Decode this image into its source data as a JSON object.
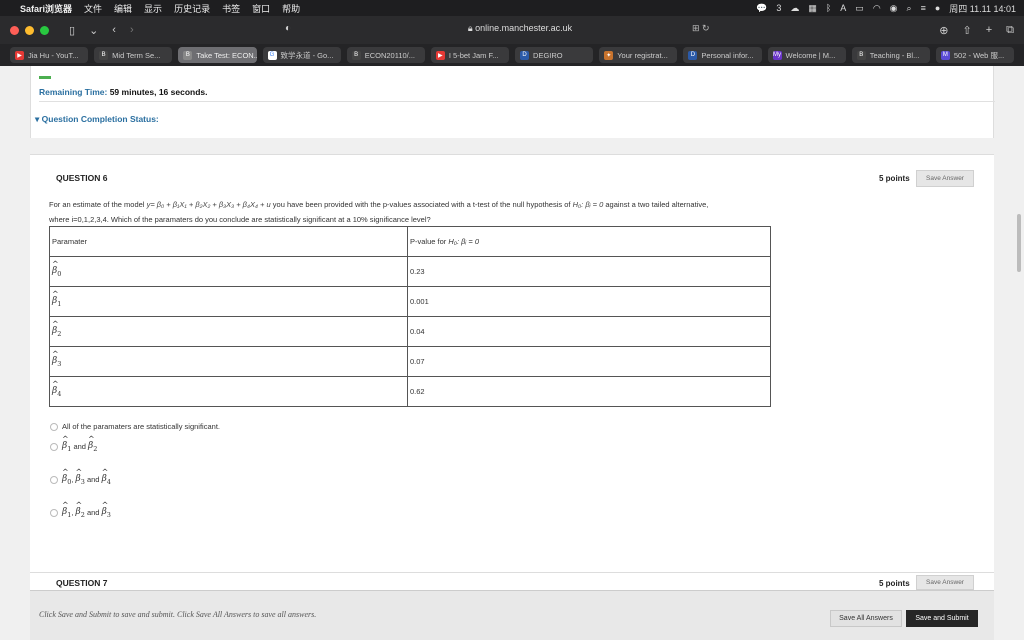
{
  "menubar": {
    "app": "Safari浏览器",
    "items": [
      "文件",
      "编辑",
      "显示",
      "历史记录",
      "书签",
      "窗口",
      "帮助"
    ],
    "wechat_count": "3",
    "clock": "周四 11.11  14:01"
  },
  "browser": {
    "url": "online.manchester.ac.uk",
    "tabs": [
      {
        "label": "Jia Hu - YouT...",
        "color": "#e53935",
        "glyph": "▶"
      },
      {
        "label": "Mid Term Se...",
        "color": "#444",
        "glyph": "B"
      },
      {
        "label": "Take Test: ECON...",
        "color": "#888",
        "glyph": "B",
        "active": true
      },
      {
        "label": "致学永道 - Go...",
        "color": "#fff",
        "glyph": "G"
      },
      {
        "label": "ECON20110/...",
        "color": "#444",
        "glyph": "B"
      },
      {
        "label": "I 5-bet Jam F...",
        "color": "#e53935",
        "glyph": "▶"
      },
      {
        "label": "DEGIRO",
        "color": "#2b5aa8",
        "glyph": "D"
      },
      {
        "label": "Your registrat...",
        "color": "#c9742e",
        "glyph": "✦"
      },
      {
        "label": "Personal infor...",
        "color": "#2b5aa8",
        "glyph": "D"
      },
      {
        "label": "Welcome | M...",
        "color": "#6a35c9",
        "glyph": "My"
      },
      {
        "label": "Teaching - Bl...",
        "color": "#444",
        "glyph": "B"
      },
      {
        "label": "502 - Web 服...",
        "color": "#5b4bd6",
        "glyph": "M"
      }
    ]
  },
  "test": {
    "remaining_label": "Remaining Time:",
    "remaining_value": "59 minutes, 16 seconds.",
    "completion_status": "Question Completion Status:"
  },
  "question6": {
    "title": "QUESTION 6",
    "points": "5 points",
    "save_label": "Save Answer",
    "text_part1": "For an estimate of the model",
    "model_formula": "y= β₀ + β₁X₁ + β₂X₂ + β₃X₃ + β₄X₄ + u",
    "text_part2": "you have been provided with the p-values associated with a t-test of the null hypothesis of",
    "null_hyp": "H₀: βᵢ = 0",
    "text_part3": "against a two tailed alternative,",
    "text_line2": "where i=0,1,2,3,4. Which of the paramaters do you conclude are statistically significant at a 10% significance level?",
    "table": {
      "header_param": "Paramater",
      "header_pvalue": "P-value for",
      "header_hyp": "H₀: βᵢ = 0",
      "rows": [
        {
          "param": "β",
          "sub": "0",
          "pvalue": "0.23"
        },
        {
          "param": "β",
          "sub": "1",
          "pvalue": "0.001"
        },
        {
          "param": "β",
          "sub": "2",
          "pvalue": "0.04"
        },
        {
          "param": "β",
          "sub": "3",
          "pvalue": "0.07"
        },
        {
          "param": "β",
          "sub": "4",
          "pvalue": "0.62"
        }
      ]
    },
    "options": {
      "a": "All of the paramaters are statistically significant.",
      "b_and": "and",
      "c_and": "and",
      "d_and": "and"
    }
  },
  "question7": {
    "title": "QUESTION 7",
    "points": "5 points",
    "save_label": "Save Answer"
  },
  "footer": {
    "instructions": "Click Save and Submit to save and submit. Click Save All Answers to save all answers.",
    "save_all": "Save All Answers",
    "submit": "Save and Submit"
  }
}
